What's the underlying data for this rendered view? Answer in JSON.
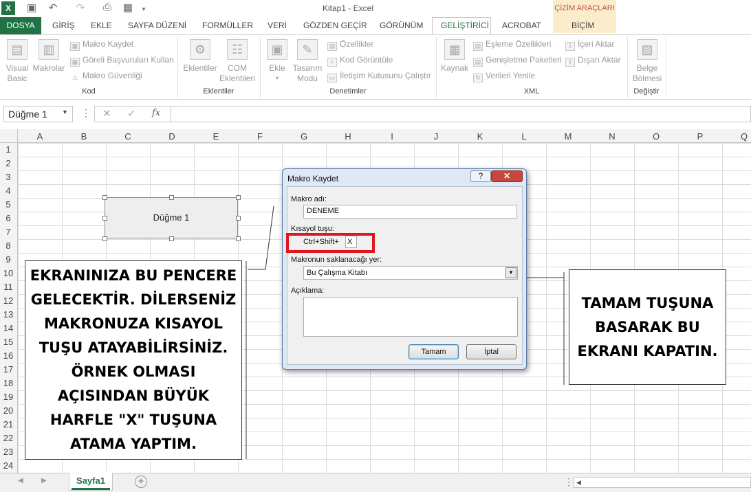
{
  "window": {
    "title": "Kitap1 - Excel",
    "contextual_group": "ÇİZİM ARAÇLARI"
  },
  "qat": {
    "save_icon": "save-icon",
    "undo_icon": "undo-icon",
    "redo_icon": "redo-icon"
  },
  "tabs": [
    {
      "label": "DOSYA"
    },
    {
      "label": "GİRİŞ"
    },
    {
      "label": "EKLE"
    },
    {
      "label": "SAYFA DÜZENİ"
    },
    {
      "label": "FORMÜLLER"
    },
    {
      "label": "VERİ"
    },
    {
      "label": "GÖZDEN GEÇİR"
    },
    {
      "label": "GÖRÜNÜM"
    },
    {
      "label": "GELİŞTİRİCİ"
    },
    {
      "label": "ACROBAT"
    },
    {
      "label": "BİÇİM"
    }
  ],
  "ribbon": {
    "kod": {
      "label": "Kod",
      "visual_basic": "Visual\nBasic",
      "makrolar": "Makrolar",
      "makro_kaydet": "Makro Kaydet",
      "goreli": "Göreli Başvuruları Kullan",
      "guvenlik": "Makro Güvenliği"
    },
    "eklentiler": {
      "label": "Eklentiler",
      "eklentiler_btn": "Eklentiler",
      "com": "COM\nEklentileri"
    },
    "denetimler": {
      "label": "Denetimler",
      "ekle": "Ekle",
      "tasarim": "Tasarım\nModu",
      "ozellikler": "Özellikler",
      "kod_goruntule": "Kod Görüntüle",
      "iletisim": "İletişim Kutusunu Çalıştır"
    },
    "xml": {
      "label": "XML",
      "kaynak": "Kaynak",
      "esleme": "Eşleme Özellikleri",
      "genisletme": "Genişletme Paketleri",
      "verileri_yenile": "Verileri Yenile",
      "iceri": "İçeri Aktar",
      "disari": "Dışarı Aktar"
    },
    "degistir": {
      "label": "Değiştir",
      "belge": "Belge\nBölmesi"
    }
  },
  "formula_bar": {
    "name_box": "Düğme 1",
    "fx": "fx",
    "value": ""
  },
  "grid": {
    "columns": [
      "A",
      "B",
      "C",
      "D",
      "E",
      "F",
      "G",
      "H",
      "I",
      "J",
      "K",
      "L",
      "M",
      "N",
      "O",
      "P",
      "Q"
    ],
    "rows": [
      "1",
      "2",
      "3",
      "4",
      "5",
      "6",
      "7",
      "8",
      "9",
      "10",
      "11",
      "12",
      "13",
      "14",
      "15",
      "16",
      "17",
      "18",
      "19",
      "20",
      "21",
      "22",
      "23",
      "24"
    ]
  },
  "shape": {
    "label": "Düğme 1"
  },
  "callouts": {
    "left": "EKRANINIZA BU PENCERE GELECEKTİR. DİLERSENİZ MAKRONUZA KISAYOL TUŞU ATAYABİLİRSİNİZ. ÖRNEK OLMASI AÇISINDAN BÜYÜK HARFLE \"X\" TUŞUNA ATAMA YAPTIM.",
    "right": "TAMAM TUŞUNA BASARAK BU EKRANI KAPATIN."
  },
  "dialog": {
    "title": "Makro Kaydet",
    "help": "?",
    "close": "✕",
    "macro_name_label": "Makro adı:",
    "macro_name_value": "DENEME",
    "shortcut_label": "Kısayol tuşu:",
    "shortcut_prefix": "Ctrl+Shift+",
    "shortcut_key": "X",
    "store_label": "Makronun saklanacağı yer:",
    "store_value": "Bu Çalışma Kitabı",
    "desc_label": "Açıklama:",
    "desc_value": "",
    "ok": "Tamam",
    "cancel": "İptal"
  },
  "sheets": [
    {
      "name": "Sayfa1"
    }
  ],
  "colors": {
    "excel_green": "#217346",
    "highlight_red": "#e4141e",
    "context_tab": "#c0504d"
  }
}
